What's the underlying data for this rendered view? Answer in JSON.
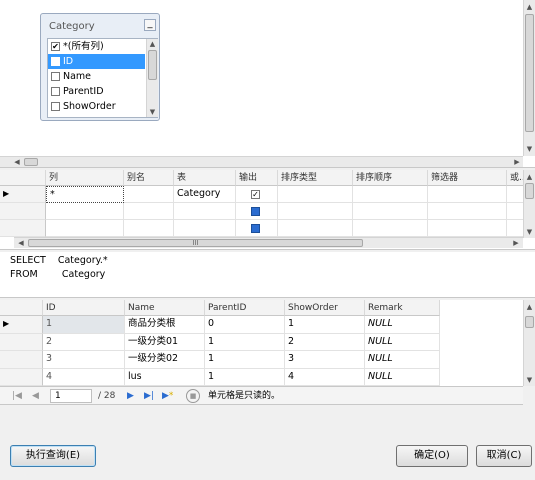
{
  "diagram": {
    "table_box": {
      "title": "Category",
      "minimize_glyph": "_",
      "columns": [
        {
          "label": "*(所有列)",
          "checked": true,
          "selected": false
        },
        {
          "label": "ID",
          "checked": false,
          "selected": true
        },
        {
          "label": "Name",
          "checked": false,
          "selected": false
        },
        {
          "label": "ParentID",
          "checked": false,
          "selected": false
        },
        {
          "label": "ShowOrder",
          "checked": false,
          "selected": false
        }
      ]
    }
  },
  "criteria": {
    "headers": [
      "列",
      "别名",
      "表",
      "输出",
      "排序类型",
      "排序顺序",
      "筛选器",
      "或..."
    ],
    "rows": [
      {
        "column": "*",
        "alias": "",
        "table": "Category",
        "output": true
      }
    ],
    "scroll_glyph": "III"
  },
  "sql": {
    "line1": "SELECT    Category.*",
    "line2": "FROM        Category"
  },
  "results": {
    "headers": [
      "ID",
      "Name",
      "ParentID",
      "ShowOrder",
      "Remark"
    ],
    "rows": [
      [
        "1",
        "商品分类根",
        "0",
        "1",
        "NULL"
      ],
      [
        "2",
        "一级分类01",
        "1",
        "2",
        "NULL"
      ],
      [
        "3",
        "一级分类02",
        "1",
        "3",
        "NULL"
      ],
      [
        "4",
        "lus",
        "1",
        "4",
        "NULL"
      ]
    ]
  },
  "navigator": {
    "current": "1",
    "total": "/ 28",
    "status": "单元格是只读的。"
  },
  "buttons": {
    "execute": "执行查询(E)",
    "ok": "确定(O)",
    "cancel": "取消(C)"
  },
  "colors": {
    "selection": "#3399ff",
    "accent_blue": "#2b6cd0",
    "window_bg": "#f0f0f0"
  }
}
